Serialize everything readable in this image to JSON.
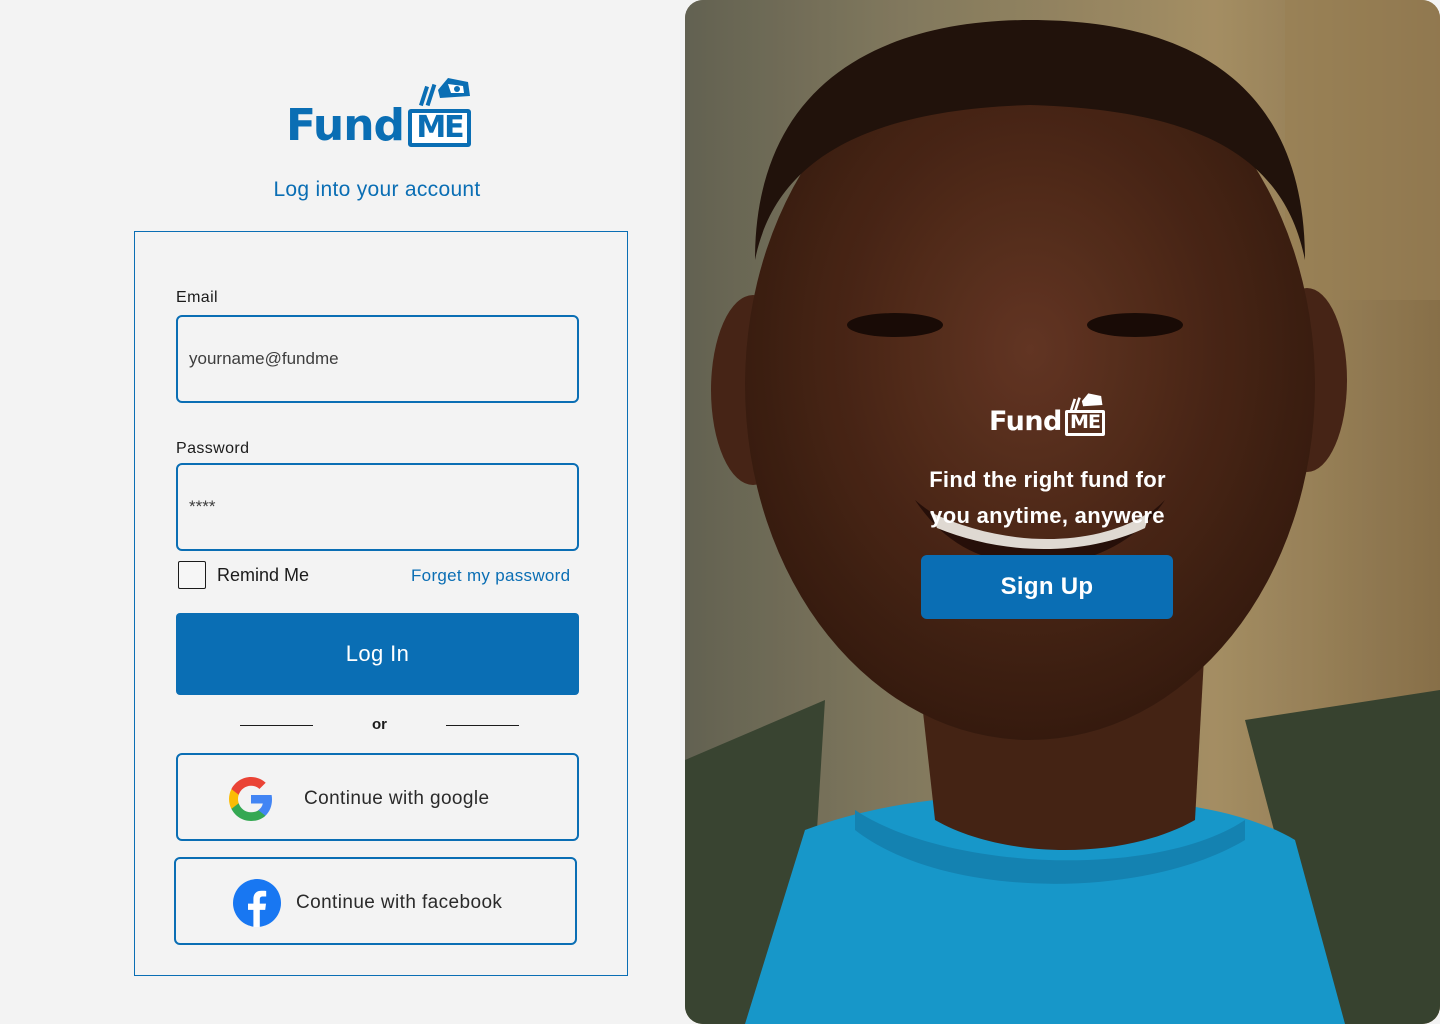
{
  "brand": {
    "word": "Fund",
    "badge": "ME",
    "color": "#0a6eb4"
  },
  "login": {
    "subtitle": "Log into your account",
    "email_label": "Email",
    "email_value": "yourname@fundme",
    "password_label": "Password",
    "password_value": "****",
    "remember_label": "Remind Me",
    "remember_checked": false,
    "forgot_label": "Forget my password",
    "login_button": "Log In",
    "divider": "or",
    "google_button": "Continue with google",
    "facebook_button": "Continue with facebook"
  },
  "hero": {
    "tagline_line1": "Find the right fund for",
    "tagline_line2": "you anytime, anywere",
    "signup_button": "Sign Up",
    "image": "smiling-child-photo"
  },
  "icons": {
    "google": "google-icon",
    "facebook": "facebook-icon",
    "checkbox": "checkbox-icon"
  },
  "colors": {
    "accent": "#0a6eb4",
    "background": "#f3f3f3",
    "facebook": "#1877f2"
  }
}
